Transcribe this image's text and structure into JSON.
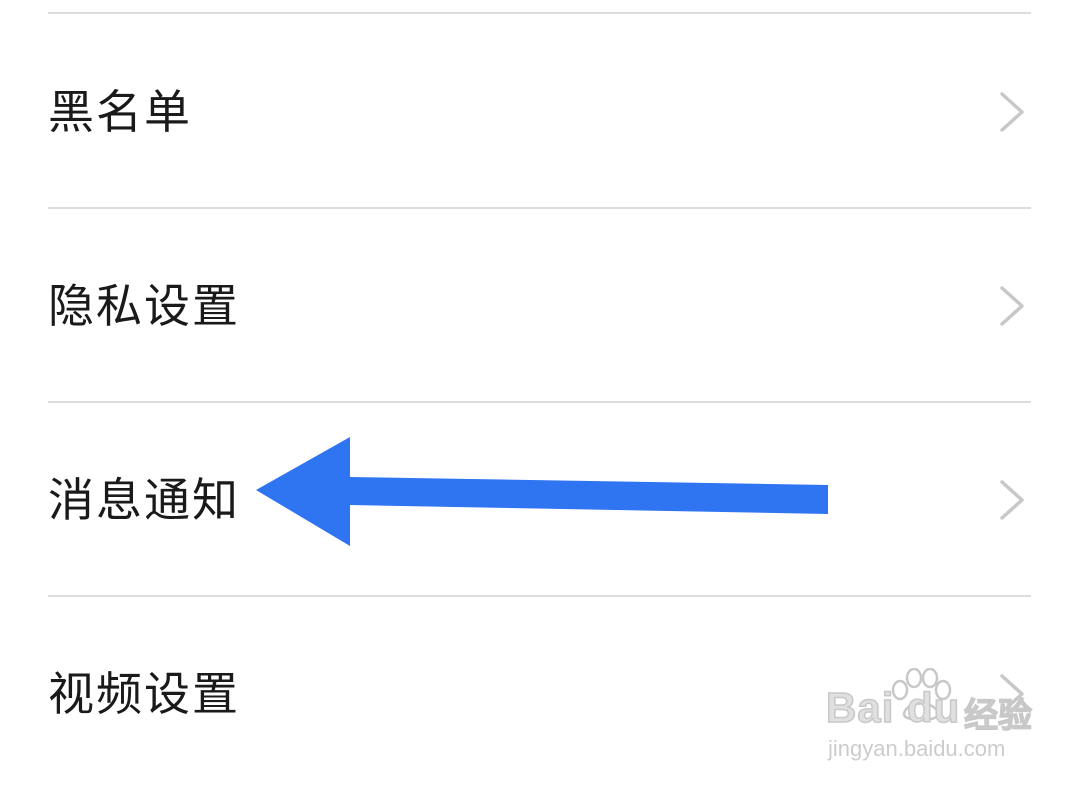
{
  "settings_menu": {
    "items": [
      {
        "label": "黑名单"
      },
      {
        "label": "隐私设置"
      },
      {
        "label": "消息通知"
      },
      {
        "label": "视频设置"
      }
    ]
  },
  "icons": {
    "row_chevron": "chevron-right-icon",
    "annotation": "left-arrow-annotation"
  },
  "colors": {
    "background": "#ffffff",
    "divider": "#dddddd",
    "label": "#1a1a1a",
    "chevron": "#c8c8c8",
    "arrow": "#2f74f0"
  },
  "watermark": {
    "brand": "Bai du",
    "suffix": "经验",
    "url": "jingyan.baidu.com"
  }
}
